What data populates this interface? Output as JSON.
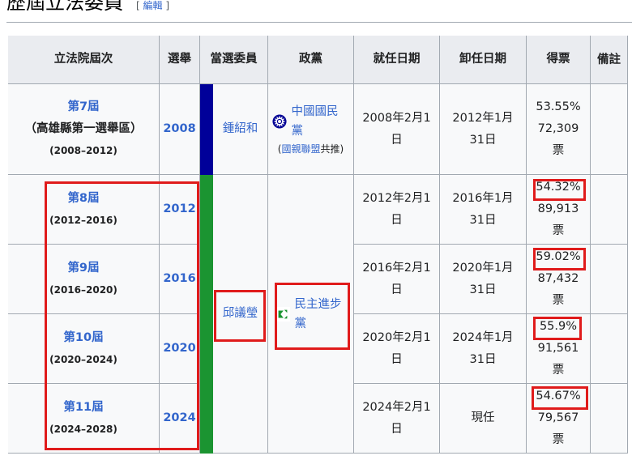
{
  "section": {
    "title": "歷屆立法委員",
    "edit_bracket_open": "[",
    "edit_link": "編輯",
    "edit_bracket_close": "]"
  },
  "headers": [
    "立法院屆次",
    "選舉",
    "當選委員",
    "政黨",
    "就任日期",
    "卸任日期",
    "得票",
    "備註"
  ],
  "party_colors": {
    "kmt": "#000099",
    "dpp": "#1b9431"
  },
  "rows": [
    {
      "term": "第7屆",
      "term_suffix": "（高雄縣第一選舉區）",
      "years": "(2008–2012)",
      "election": "2008",
      "start": "2008年2月1日",
      "end": "2012年1月31日",
      "pct": "53.55%",
      "votes": "72,309",
      "unit": "票"
    },
    {
      "term": "第8屆",
      "years": "(2012–2016)",
      "election": "2012",
      "start": "2012年2月1日",
      "end": "2016年1月31日",
      "pct": "54.32%",
      "votes": "89,913",
      "unit": "票"
    },
    {
      "term": "第9屆",
      "years": "(2016–2020)",
      "election": "2016",
      "start": "2016年2月1日",
      "end": "2020年1月31日",
      "pct": "59.02%",
      "votes": "87,432",
      "unit": "票"
    },
    {
      "term": "第10屆",
      "years": "(2020–2024)",
      "election": "2020",
      "start": "2020年2月1日",
      "end": "2024年1月31日",
      "pct": "55.9%",
      "votes": "91,561",
      "unit": "票"
    },
    {
      "term": "第11屆",
      "years": "(2024–2028)",
      "election": "2024",
      "start": "2024年2月1日",
      "end": "現任",
      "pct": "54.67%",
      "votes": "79,567",
      "unit": "票"
    }
  ],
  "members": {
    "first": "鍾紹和",
    "second": "邱議瑩"
  },
  "parties": {
    "kmt": "中國國民黨",
    "kmt_note_link": "國親聯盟",
    "kmt_note_rest": "共推",
    "dpp": "民主進步黨"
  }
}
